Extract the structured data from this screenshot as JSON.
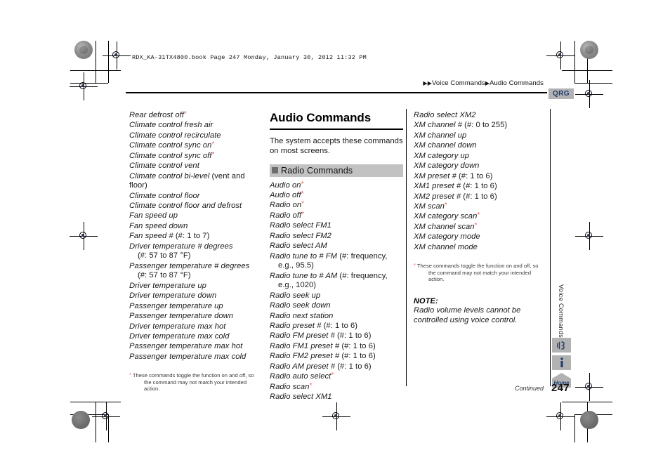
{
  "print_marks": {
    "book_line": "RDX_KA-31TX4800.book  Page 247  Monday, January 30, 2012  11:32 PM"
  },
  "header": {
    "breadcrumb_arrow": "▶",
    "breadcrumb_part1": "Voice Commands",
    "breadcrumb_part2": "Audio Commands",
    "qrg_badge": "QRG"
  },
  "left_column": {
    "commands": [
      {
        "text": "Rear defrost off",
        "asterisk": true
      },
      {
        "text": "Climate control fresh air"
      },
      {
        "text": "Climate control recirculate"
      },
      {
        "text": "Climate control sync on",
        "asterisk": true
      },
      {
        "text": "Climate control sync off",
        "asterisk": true
      },
      {
        "text": "Climate control vent"
      },
      {
        "text": "Climate control bi-level",
        "plain": " (vent and floor)"
      },
      {
        "text": "Climate control floor"
      },
      {
        "text": "Climate control floor and defrost"
      },
      {
        "text": "Fan speed up"
      },
      {
        "text": "Fan speed down"
      },
      {
        "text": "Fan speed #",
        "plain": " (#: 1 to 7)"
      },
      {
        "text": "Driver temperature # degrees",
        "cont": "(#: 57 to 87 °F)"
      },
      {
        "text": "Passenger temperature # degrees",
        "cont": "(#: 57 to 87 °F)"
      },
      {
        "text": "Driver temperature up"
      },
      {
        "text": "Driver temperature down"
      },
      {
        "text": "Passenger temperature up"
      },
      {
        "text": "Passenger temperature down"
      },
      {
        "text": "Driver temperature max hot"
      },
      {
        "text": "Driver temperature max cold"
      },
      {
        "text": "Passenger temperature max hot"
      },
      {
        "text": "Passenger temperature max cold"
      }
    ],
    "footnote_line1": "These commands toggle the function on and off, so",
    "footnote_line2": "the command may not match your intended action."
  },
  "middle_column": {
    "title": "Audio Commands",
    "intro": "The system accepts these commands on most screens.",
    "subhead": "Radio Commands",
    "commands": [
      {
        "text": "Audio on",
        "asterisk": true
      },
      {
        "text": "Audio off",
        "asterisk": true
      },
      {
        "text": "Radio on",
        "asterisk": true
      },
      {
        "text": "Radio off",
        "asterisk": true
      },
      {
        "text": "Radio select FM1"
      },
      {
        "text": "Radio select FM2"
      },
      {
        "text": "Radio select AM"
      },
      {
        "text": "Radio tune to # FM",
        "plain": " (#: frequency,",
        "cont": "e.g., 95.5)"
      },
      {
        "text": "Radio tune to # AM",
        "plain": " (#: frequency,",
        "cont": "e.g., 1020)"
      },
      {
        "text": "Radio seek up"
      },
      {
        "text": "Radio seek down"
      },
      {
        "text": "Radio next station"
      },
      {
        "text": "Radio preset #",
        "plain": " (#: 1 to 6)"
      },
      {
        "text": "Radio FM preset #",
        "plain": " (#: 1 to 6)"
      },
      {
        "text": "Radio FM1 preset #",
        "plain": " (#: 1 to 6)"
      },
      {
        "text": "Radio FM2 preset #",
        "plain": " (#: 1 to 6)"
      },
      {
        "text": "Radio AM preset #",
        "plain": " (#: 1 to 6)"
      },
      {
        "text": "Radio auto select",
        "asterisk": true
      },
      {
        "text": "Radio scan",
        "asterisk": true
      },
      {
        "text": "Radio select XM1"
      }
    ]
  },
  "right_column": {
    "commands": [
      {
        "text": "Radio select XM2"
      },
      {
        "text": "XM channel #",
        "plain": " (#: 0 to 255)"
      },
      {
        "text": "XM channel up"
      },
      {
        "text": "XM channel down"
      },
      {
        "text": "XM category up"
      },
      {
        "text": "XM category down"
      },
      {
        "text": "XM preset #",
        "plain": " (#: 1 to 6)"
      },
      {
        "text": "XM1 preset #",
        "plain": " (#: 1 to 6)"
      },
      {
        "text": "XM2 preset #",
        "plain": " (#: 1 to 6)"
      },
      {
        "text": "XM scan",
        "asterisk": true
      },
      {
        "text": "XM category scan",
        "asterisk": true
      },
      {
        "text": "XM channel scan",
        "asterisk": true
      },
      {
        "text": "XM category mode"
      },
      {
        "text": "XM channel mode"
      }
    ],
    "footnote_line1": "These commands toggle the function on and off, so",
    "footnote_line2": "the command may not match your intended action.",
    "note_label": "NOTE:",
    "note_body": "Radio volume levels cannot be controlled using voice control."
  },
  "side_tab": {
    "label": "Voice Commands",
    "home_icon_label": "Home"
  },
  "footer": {
    "continued": "Continued",
    "page_number": "247"
  },
  "colors": {
    "asterisk_red": "#e2645a",
    "qrg_blue": "#1c3a6e",
    "subhead_gray": "#c2c2c2",
    "badge_gray": "#b2b2b2"
  }
}
